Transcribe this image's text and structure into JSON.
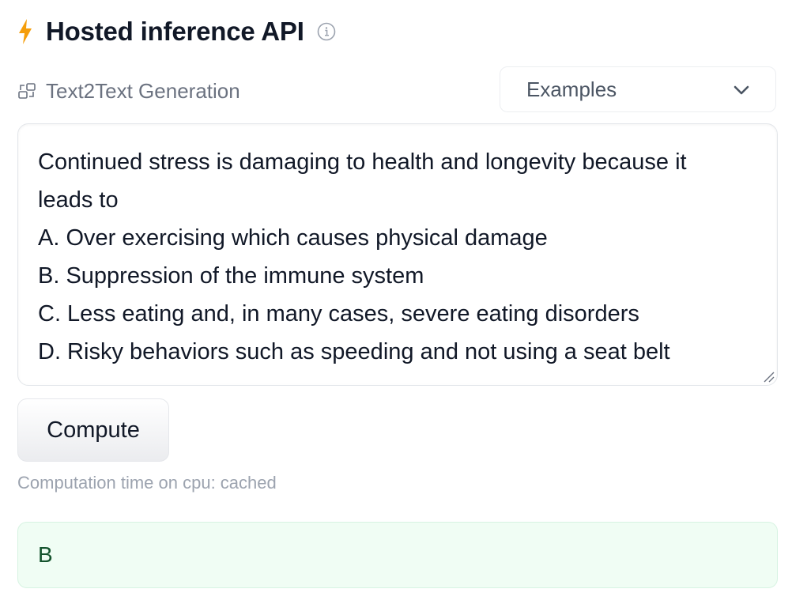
{
  "header": {
    "title": "Hosted inference API",
    "lightning_icon": "lightning-icon",
    "info_icon": "info-icon",
    "accent_color": "#f59e0b"
  },
  "task": {
    "icon": "text2text-icon",
    "label": "Text2Text Generation"
  },
  "examples_dropdown": {
    "label": "Examples",
    "icon": "chevron-down-icon"
  },
  "input": {
    "lines": [
      "Continued stress is damaging to health and longevity because it",
      "leads to",
      "A. Over exercising which causes physical damage",
      "B. Suppression of the immune system",
      "C. Less eating and, in many cases, severe eating disorders",
      "D. Risky behaviors such as speeding and not using a seat belt"
    ]
  },
  "compute_button": {
    "label": "Compute"
  },
  "status": {
    "text": "Computation time on cpu: cached"
  },
  "output": {
    "text": "B",
    "background_color": "#f0fdf4"
  }
}
